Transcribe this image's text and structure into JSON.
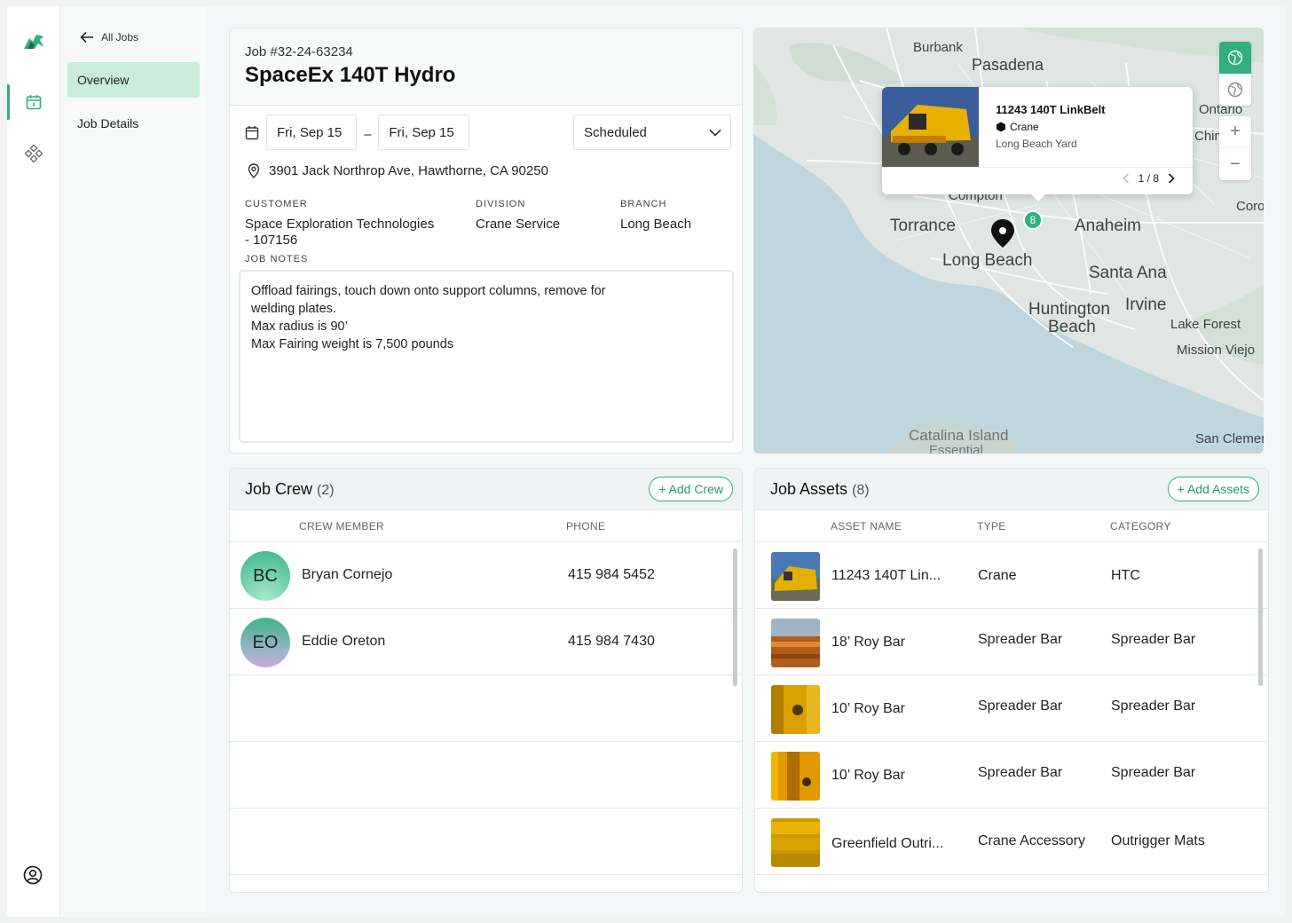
{
  "nav": {
    "back_label": "All Jobs",
    "items": [
      {
        "label": "Overview"
      },
      {
        "label": "Job Details"
      }
    ]
  },
  "job": {
    "number": "Job #32-24-63234",
    "title": "SpaceEx 140T Hydro",
    "start_date": "Fri, Sep 15",
    "end_date": "Fri, Sep 15",
    "date_separator": "–",
    "status": "Scheduled",
    "address": "3901 Jack Northrop Ave, Hawthorne, CA 90250",
    "customer_label": "CUSTOMER",
    "customer_line1": "Space Exploration Technologies",
    "customer_line2": "- 107156",
    "division_label": "DIVISION",
    "division": "Crane Service",
    "branch_label": "BRANCH",
    "branch": "Long Beach",
    "notes_label": "JOB NOTES",
    "notes": [
      "Offload fairings, touch down onto support columns, remove for",
      "welding plates.",
      "Max radius is 90’",
      "Max Fairing weight is 7,500 pounds"
    ]
  },
  "map": {
    "labels": [
      "Burbank",
      "Pasadena",
      "Ontario",
      "Chino",
      "Compton",
      "Torrance",
      "Anaheim",
      "Corona",
      "Long Beach",
      "Santa Ana",
      "Huntington",
      "Beach",
      "Irvine",
      "Lake Forest",
      "Mission Viejo",
      "Catalina Island",
      "Essential",
      "San Clemente"
    ],
    "cluster_count": "8",
    "popup": {
      "title": "11243 140T LinkBelt",
      "type": "Crane",
      "yard": "Long Beach Yard",
      "pager": "1 / 8"
    },
    "zoom_in": "+",
    "zoom_out": "−"
  },
  "crew": {
    "title": "Job Crew",
    "count": "(2)",
    "add_label": "+ Add Crew",
    "columns": [
      "CREW MEMBER",
      "PHONE"
    ],
    "rows": [
      {
        "initials": "BC",
        "name": "Bryan Cornejo",
        "phone": "415 984 5452"
      },
      {
        "initials": "EO",
        "name": "Eddie Oreton",
        "phone": "415 984 7430"
      }
    ]
  },
  "assets": {
    "title": "Job Assets",
    "count": "(8)",
    "add_label": "+ Add Assets",
    "columns": [
      "ASSET NAME",
      "TYPE",
      "CATEGORY"
    ],
    "rows": [
      {
        "name": "11243 140T Lin...",
        "type": "Crane",
        "category": "HTC"
      },
      {
        "name": "18’ Roy Bar",
        "type": "Spreader Bar",
        "category": "Spreader Bar"
      },
      {
        "name": "10’ Roy Bar",
        "type": "Spreader Bar",
        "category": "Spreader Bar"
      },
      {
        "name": "10’ Roy Bar",
        "type": "Spreader Bar",
        "category": "Spreader Bar"
      },
      {
        "name": "Greenfield Outri...",
        "type": "Crane Accessory",
        "category": "Outrigger Mats"
      }
    ]
  },
  "colors": {
    "accent": "#2fb07c",
    "active_nav": "#c9ecdc",
    "water": "#bfd6dc",
    "land": "#dfe6e3"
  }
}
